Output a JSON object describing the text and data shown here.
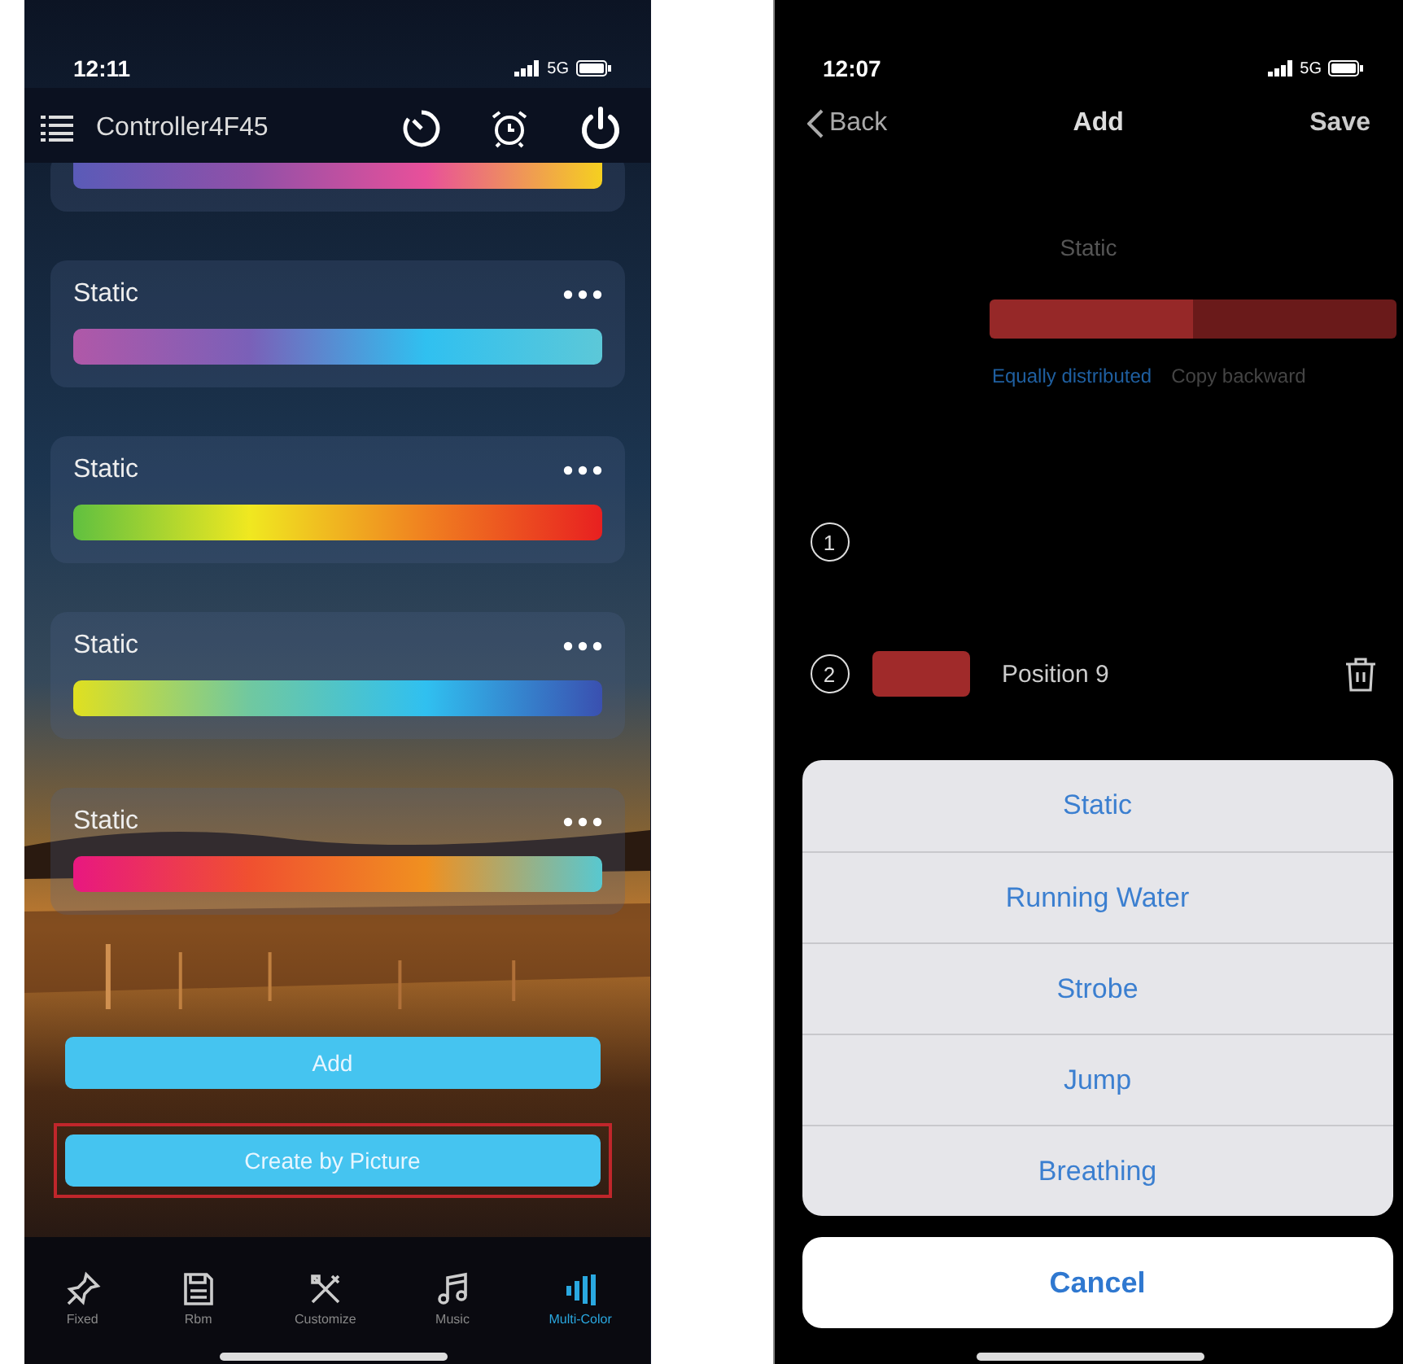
{
  "left_phone": {
    "status_bar": {
      "time": "12:11",
      "network": "5G"
    },
    "header": {
      "title": "Controller4F45"
    },
    "cards": [
      {
        "stops": [
          {
            "color": "#5a5bb8"
          },
          {
            "color": "#9050a8"
          },
          {
            "color": "#e8509a"
          },
          {
            "color": "#f5d020"
          }
        ]
      },
      {
        "label": "Static",
        "stops": [
          {
            "color": "#b058a8"
          },
          {
            "color": "#7a60b8"
          },
          {
            "color": "#30c0f0"
          },
          {
            "color": "#5cc8d8"
          }
        ]
      },
      {
        "label": "Static",
        "stops": [
          {
            "color": "#60c040"
          },
          {
            "color": "#f0e820"
          },
          {
            "color": "#f08020"
          },
          {
            "color": "#e82020"
          }
        ]
      },
      {
        "label": "Static",
        "stops": [
          {
            "color": "#e0e020"
          },
          {
            "color": "#70c8a0"
          },
          {
            "color": "#30c0f0"
          },
          {
            "color": "#3a50b0"
          }
        ]
      },
      {
        "label": "Static",
        "stops": [
          {
            "color": "#e81880"
          },
          {
            "color": "#f05030"
          },
          {
            "color": "#f09020"
          },
          {
            "color": "#58c8d0"
          }
        ]
      }
    ],
    "buttons": [
      {
        "label": "Add",
        "highlighted": false
      },
      {
        "label": "Create by Picture",
        "highlighted": true
      }
    ],
    "tabs": [
      {
        "label": "Fixed",
        "kind": "pin",
        "selected": false
      },
      {
        "label": "Rbm",
        "kind": "save",
        "selected": false
      },
      {
        "label": "Customize",
        "kind": "tools",
        "selected": false
      },
      {
        "label": "Music",
        "kind": "music",
        "selected": false
      },
      {
        "label": "Multi-Color",
        "kind": "bars",
        "selected": true
      }
    ]
  },
  "right_phone": {
    "status_bar": {
      "time": "12:07",
      "network": "5G"
    },
    "nav": {
      "back": "Back",
      "title": "Add",
      "action": "Save"
    },
    "mode": "Static",
    "segments": [
      {
        "color": "#962828"
      },
      {
        "color": "#6a1a1a"
      }
    ],
    "options": [
      {
        "label": "Equally distributed",
        "selected": true
      },
      {
        "label": "Copy backward",
        "selected": false
      }
    ],
    "points": [
      {
        "number": "1"
      },
      {
        "number": "2",
        "color": "#a02a2a",
        "label": "Position 9"
      }
    ],
    "action_sheet": {
      "items": [
        "Static",
        "Running Water",
        "Strobe",
        "Jump",
        "Breathing"
      ],
      "cancel": "Cancel"
    }
  }
}
